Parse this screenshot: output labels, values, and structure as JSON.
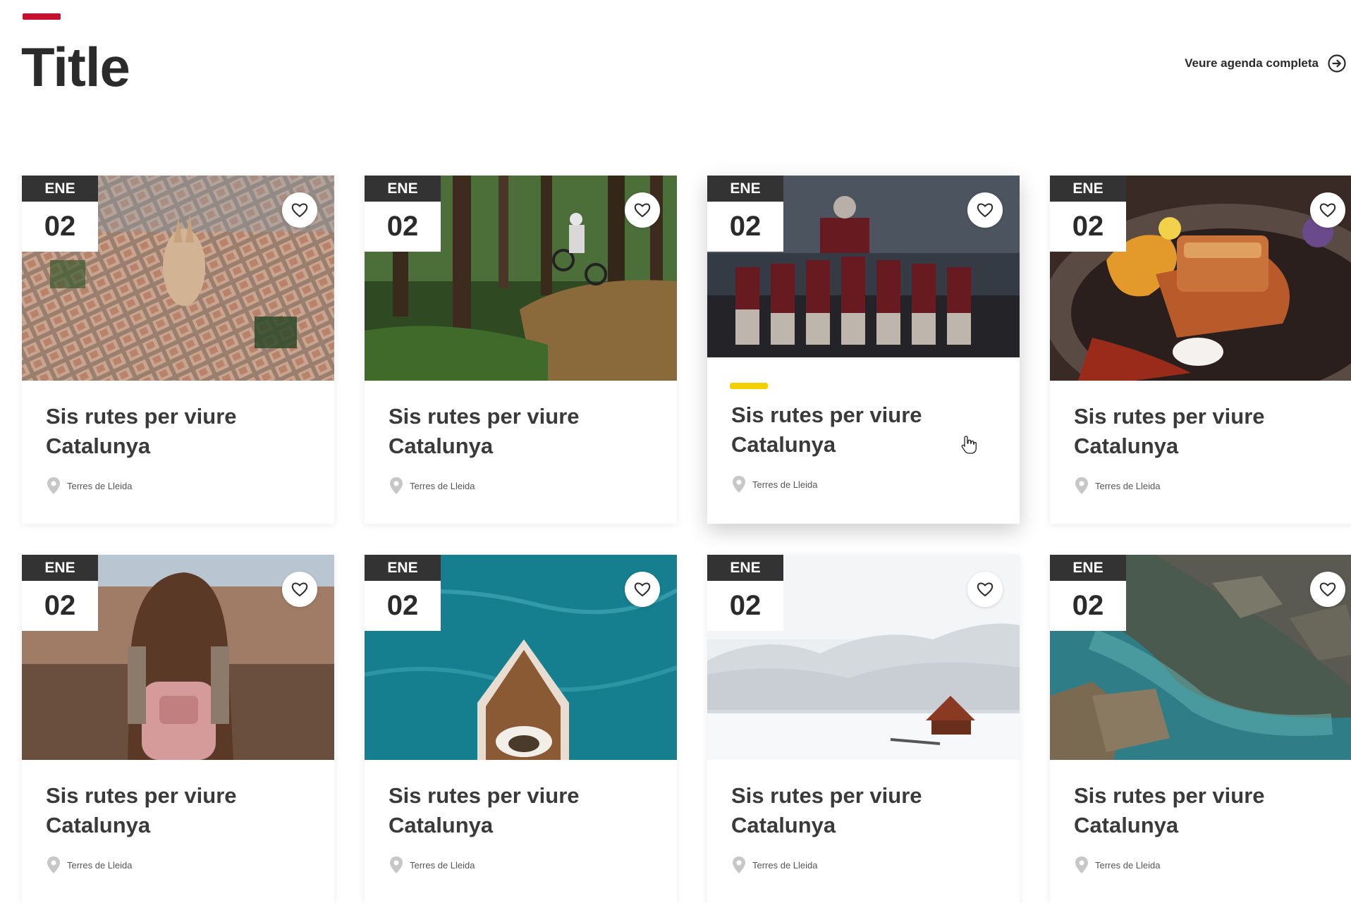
{
  "header": {
    "title": "Title",
    "agenda_link": "Veure agenda completa",
    "agenda_icon": "arrow-right-circle-icon",
    "accent_color": "#c8102e"
  },
  "hover_accent_color": "#f5d000",
  "cards": [
    {
      "month": "ENE",
      "day": "02",
      "title": "Sis rutes per viure Catalunya",
      "location": "Terres de Lleida",
      "image": "aerial-city-photo"
    },
    {
      "month": "ENE",
      "day": "02",
      "title": "Sis rutes per viure Catalunya",
      "location": "Terres de Lleida",
      "image": "mountain-bike-forest-photo"
    },
    {
      "month": "ENE",
      "day": "02",
      "title": "Sis rutes per viure Catalunya",
      "location": "Terres de Lleida",
      "image": "castellers-photo",
      "hovered": true
    },
    {
      "month": "ENE",
      "day": "02",
      "title": "Sis rutes per viure Catalunya",
      "location": "Terres de Lleida",
      "image": "food-dish-photo"
    },
    {
      "month": "ENE",
      "day": "02",
      "title": "Sis rutes per viure Catalunya",
      "location": "Terres de Lleida",
      "image": "woman-backpack-view-photo"
    },
    {
      "month": "ENE",
      "day": "02",
      "title": "Sis rutes per viure Catalunya",
      "location": "Terres de Lleida",
      "image": "boat-sea-photo"
    },
    {
      "month": "ENE",
      "day": "02",
      "title": "Sis rutes per viure Catalunya",
      "location": "Terres de Lleida",
      "image": "snowy-cabin-photo"
    },
    {
      "month": "ENE",
      "day": "02",
      "title": "Sis rutes per viure Catalunya",
      "location": "Terres de Lleida",
      "image": "rocky-cove-photo"
    }
  ]
}
